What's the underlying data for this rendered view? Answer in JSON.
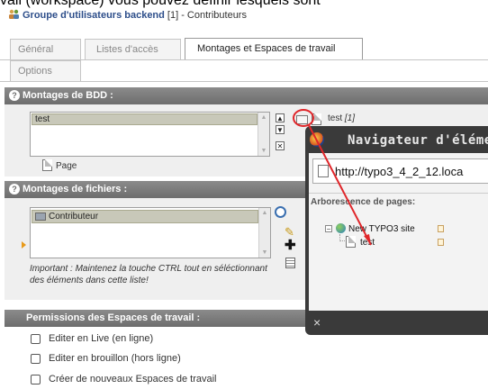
{
  "intro": "vail (workspace) vous pouvez définir lesquels sont",
  "title": {
    "bold": "Groupe d'utilisateurs backend",
    "rest": " [1] - Contributeurs"
  },
  "tabs": [
    "Général",
    "Listes d'accès",
    "Montages et Espaces de travail",
    "Options"
  ],
  "db_mounts": {
    "header": "Montages de BDD :",
    "selected": "test",
    "target_label": "test",
    "target_id": "[1]",
    "page_label": "Page"
  },
  "file_mounts": {
    "header": "Montages de fichiers :",
    "selected": "Contributeur",
    "note": "Important : Maintenez la touche CTRL tout en séléctionnant des éléments dans cette liste!"
  },
  "workspace": {
    "header": "Permissions des Espaces de travail :",
    "options": [
      "Editer en Live (en ligne)",
      "Editer en brouillon (hors ligne)",
      "Créer de nouveaux Espaces de travail"
    ]
  },
  "popup": {
    "title": "Navigateur d'éléme",
    "url": "http://typo3_4_2_12.loca",
    "tree_label": "Arborescence de pages:",
    "root": "New TYPO3 site",
    "child": "test",
    "close": "×"
  },
  "colors": {
    "section_header": "#7a7a7a",
    "panel": "#efefef",
    "arrow": "#e0262a",
    "popup_frame": "#3a3a3a"
  }
}
